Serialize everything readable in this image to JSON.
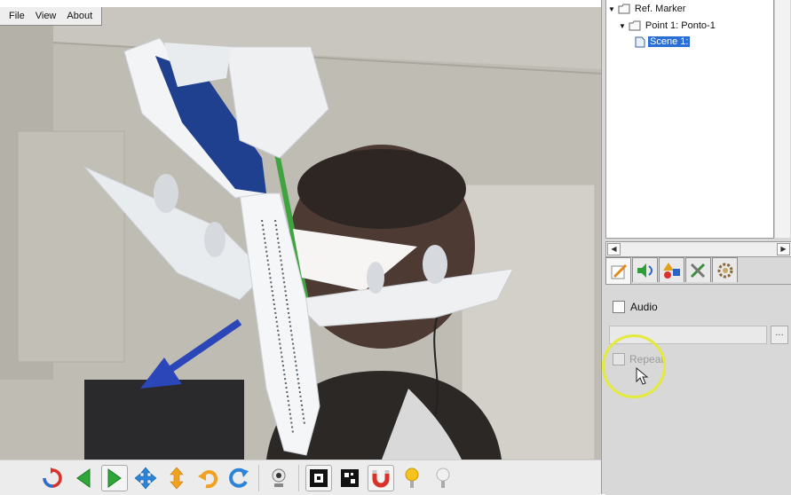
{
  "menu": {
    "file": "File",
    "view": "View",
    "about": "About"
  },
  "tree": {
    "root_label": "Ref. Marker",
    "point_label": "Point 1: Ponto-1",
    "scene_label": "Scene 1:"
  },
  "properties": {
    "audio_label": "Audio",
    "audio_checked": false,
    "audio_file_value": "",
    "browse_label": "...",
    "repeat_label": "Repeat",
    "repeat_checked": false,
    "repeat_enabled": false
  },
  "tabs": [
    {
      "name": "edit-tab",
      "icon": "pencil-note-icon",
      "active": true
    },
    {
      "name": "audio-tab",
      "icon": "speaker-icon",
      "active": false
    },
    {
      "name": "shapes-tab",
      "icon": "shapes-icon",
      "active": false
    },
    {
      "name": "tools-tab",
      "icon": "tools-icon",
      "active": false
    },
    {
      "name": "settings-tab",
      "icon": "gear-icon",
      "active": false
    }
  ],
  "toolbar": [
    {
      "name": "reset-button",
      "icon": "refresh-icon"
    },
    {
      "name": "previous-button",
      "icon": "arrow-left-icon"
    },
    {
      "name": "play-button",
      "icon": "play-icon"
    },
    {
      "name": "move-button",
      "icon": "move-arrows-icon"
    },
    {
      "name": "vertical-move-button",
      "icon": "updown-arrow-icon"
    },
    {
      "name": "undo-button",
      "icon": "undo-icon"
    },
    {
      "name": "redo-button",
      "icon": "redo-icon"
    },
    {
      "name": "webcam-button",
      "icon": "webcam-icon"
    },
    {
      "name": "marker-button",
      "icon": "marker-icon"
    },
    {
      "name": "marker-pattern-button",
      "icon": "marker-pattern-icon"
    },
    {
      "name": "magnet-button",
      "icon": "magnet-icon"
    },
    {
      "name": "light-on-button",
      "icon": "light-on-icon"
    },
    {
      "name": "light-off-button",
      "icon": "light-off-icon"
    }
  ],
  "colors": {
    "selection": "#2a6fd6",
    "highlight_ring": "#e4ea3a",
    "livery_blue": "#1f3f8f"
  }
}
